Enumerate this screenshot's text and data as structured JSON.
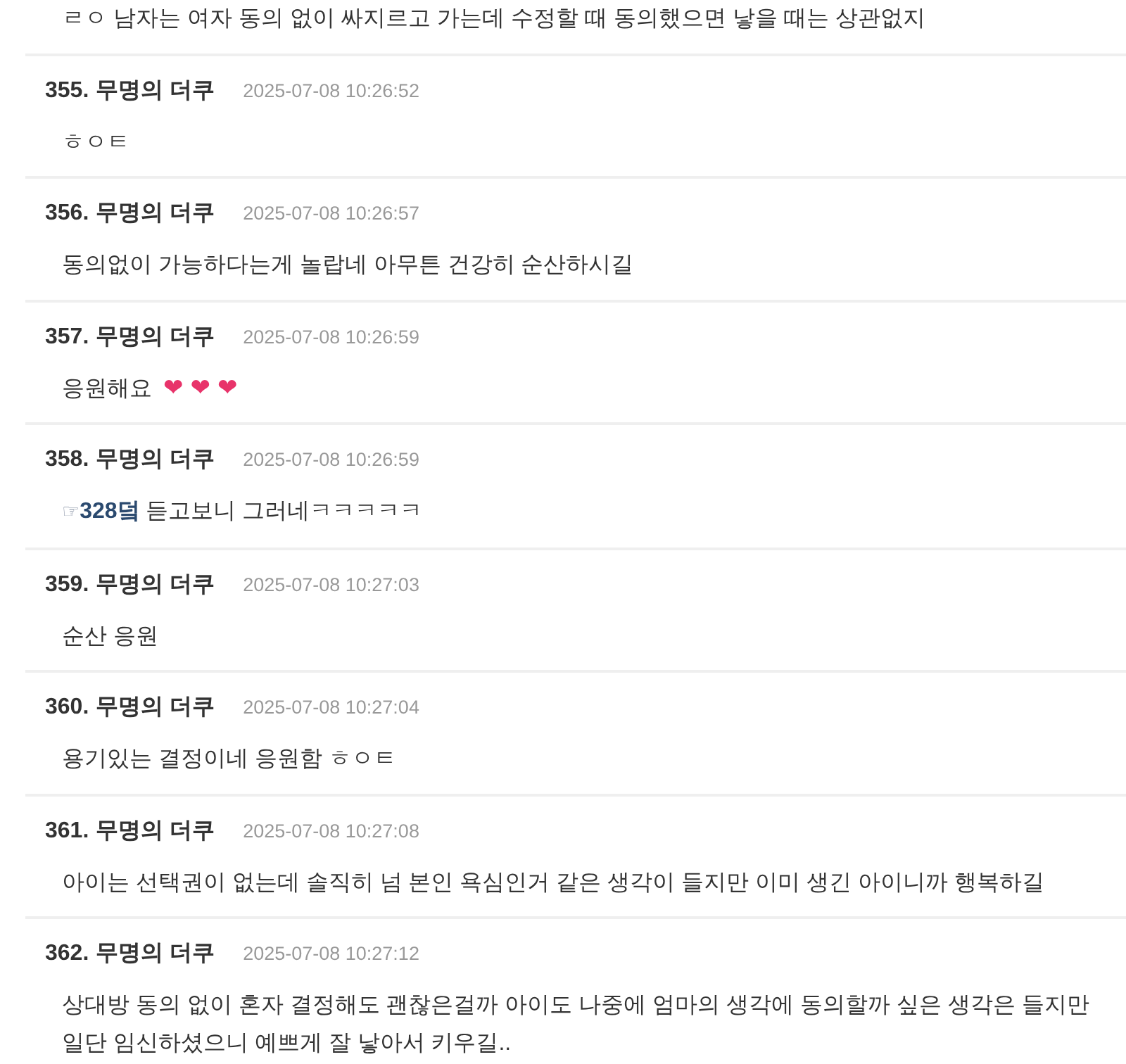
{
  "comments": [
    {
      "body": {
        "text": "ㄹㅇ 남자는 여자 동의 없이 싸지르고 가는데 수정할 때 동의했으면 낳을 때는 상관없지"
      }
    },
    {
      "number": "355.",
      "author": "무명의 더쿠",
      "timestamp": "2025-07-08 10:26:52",
      "body": {
        "text": "ㅎㅇㅌ"
      }
    },
    {
      "number": "356.",
      "author": "무명의 더쿠",
      "timestamp": "2025-07-08 10:26:57",
      "body": {
        "text": "동의없이 가능하다는게 놀랍네 아무튼 건강히 순산하시길"
      }
    },
    {
      "number": "357.",
      "author": "무명의 더쿠",
      "timestamp": "2025-07-08 10:26:59",
      "body": {
        "text": "응원해요",
        "emojis": [
          "❤",
          "❤",
          "❤"
        ]
      }
    },
    {
      "number": "358.",
      "author": "무명의 더쿠",
      "timestamp": "2025-07-08 10:26:59",
      "body": {
        "reply": {
          "mark": "☞",
          "label": "328덬"
        },
        "text": "듣고보니 그러네ㅋㅋㅋㅋㅋ"
      }
    },
    {
      "number": "359.",
      "author": "무명의 더쿠",
      "timestamp": "2025-07-08 10:27:03",
      "body": {
        "text": "순산 응원"
      }
    },
    {
      "number": "360.",
      "author": "무명의 더쿠",
      "timestamp": "2025-07-08 10:27:04",
      "body": {
        "text": "용기있는 결정이네 응원함 ㅎㅇㅌ"
      }
    },
    {
      "number": "361.",
      "author": "무명의 더쿠",
      "timestamp": "2025-07-08 10:27:08",
      "body": {
        "text": "아이는 선택권이 없는데 솔직히 넘 본인 욕심인거 같은 생각이 들지만 이미 생긴 아이니까 행복하길"
      }
    },
    {
      "number": "362.",
      "author": "무명의 더쿠",
      "timestamp": "2025-07-08 10:27:12",
      "body": {
        "text": "상대방 동의 없이 혼자 결정해도 괜찮은걸까 아이도 나중에 엄마의 생각에 동의할까 싶은 생각은 들지만 일단 임신하셨으니 예쁘게 잘 낳아서 키우길.."
      }
    }
  ]
}
